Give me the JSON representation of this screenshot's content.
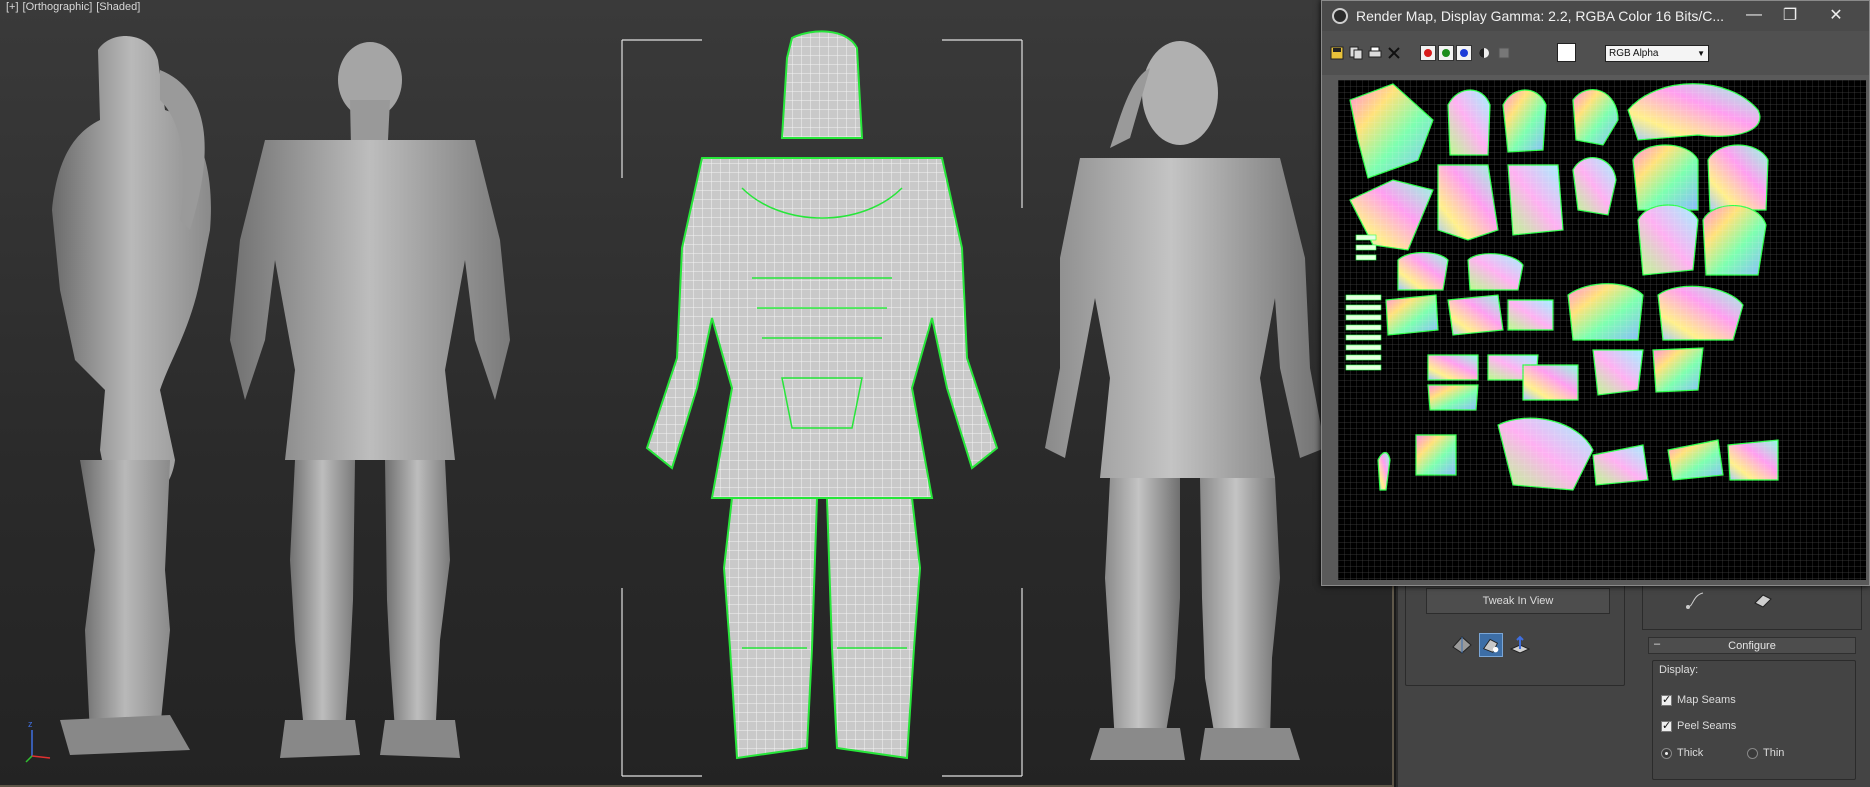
{
  "viewport": {
    "label_parts": [
      "[+]",
      "[Orthographic]",
      "[Shaded]"
    ]
  },
  "render_window": {
    "title": "Render Map, Display Gamma: 2.2, RGBA Color 16 Bits/C...",
    "channel_select": "RGB Alpha",
    "minimize": "—",
    "maximize": "❐",
    "close": "✕"
  },
  "panel": {
    "tweak_button": "Tweak In View",
    "configure": {
      "collapse": "–",
      "title": "Configure"
    },
    "display_label": "Display:",
    "map_seams": "Map Seams",
    "peel_seams": "Peel Seams",
    "thick": "Thick",
    "thin": "Thin",
    "map_seams_checked": true,
    "peel_seams_checked": true,
    "seam_width": "Thick"
  },
  "colors": {
    "wire_selected": "#27e63a",
    "viewport_bg": "#2b2b2b",
    "panel_bg": "#444444"
  }
}
